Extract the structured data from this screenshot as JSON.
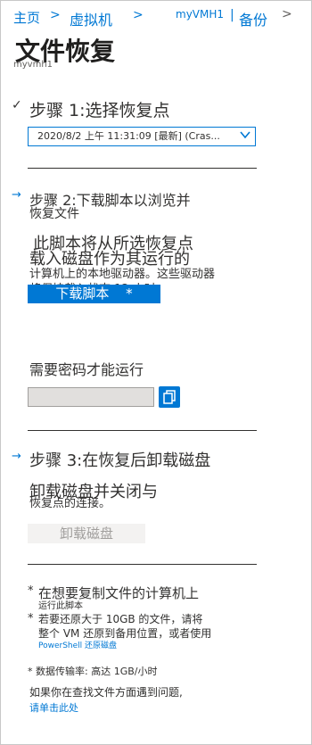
{
  "breadcrumb": {
    "home": "主页",
    "sep1": ">",
    "vm": "虚拟机",
    "sep2": ">",
    "current_a": "myVMH1",
    "current_sep": "|",
    "current_b": "备份",
    "sep3": ">"
  },
  "page": {
    "title": "文件恢复",
    "subtitle": "myvmh1"
  },
  "step1": {
    "check": "✓",
    "label": "步骤 1:选择恢复点",
    "select_value": "2020/8/2 上午 11:31:09 [最新] (Cras..."
  },
  "step2": {
    "arrow": "→",
    "label_line1": "步骤 2:下载脚本以浏览并",
    "label_line2": "恢复文件",
    "desc_line1": "此脚本将从所选恢复点",
    "desc_line2": "载入磁盘作为其运行的",
    "desc_line3": "计算机上的本地驱动器。这些驱动器",
    "desc_line4": "将保持载入状态 12 小时。",
    "download_button": "下载脚本",
    "download_star": "*",
    "password_label": "需要密码才能运行"
  },
  "step3": {
    "arrow": "→",
    "label": "步骤 3:在恢复后卸载磁盘",
    "desc_line1": "卸载磁盘并关闭与",
    "desc_line2": "恢复点的连接。",
    "unmount_button": "卸载磁盘"
  },
  "notes": {
    "n1_star": "*",
    "n1_line1": "在想要复制文件的计算机上",
    "n1_line2": "运行此脚本",
    "n2_star": "*",
    "n2_line1": "若要还原大于 10GB 的文件，请将",
    "n2_line2": "整个 VM 还原到备用位置，或者使用",
    "n2_link": "PowerShell 还原磁盘",
    "n3": "* 数据传输率: 高达 1GB/小时",
    "help_text": "如果你在查找文件方面遇到问题,",
    "help_link": "请单击此处"
  },
  "colors": {
    "accent": "#0078d4",
    "text": "#323130",
    "disabled_bg": "#f3f2f1"
  },
  "icons": {
    "select_chevron": "chevron-down-icon",
    "copy": "copy-icon"
  }
}
